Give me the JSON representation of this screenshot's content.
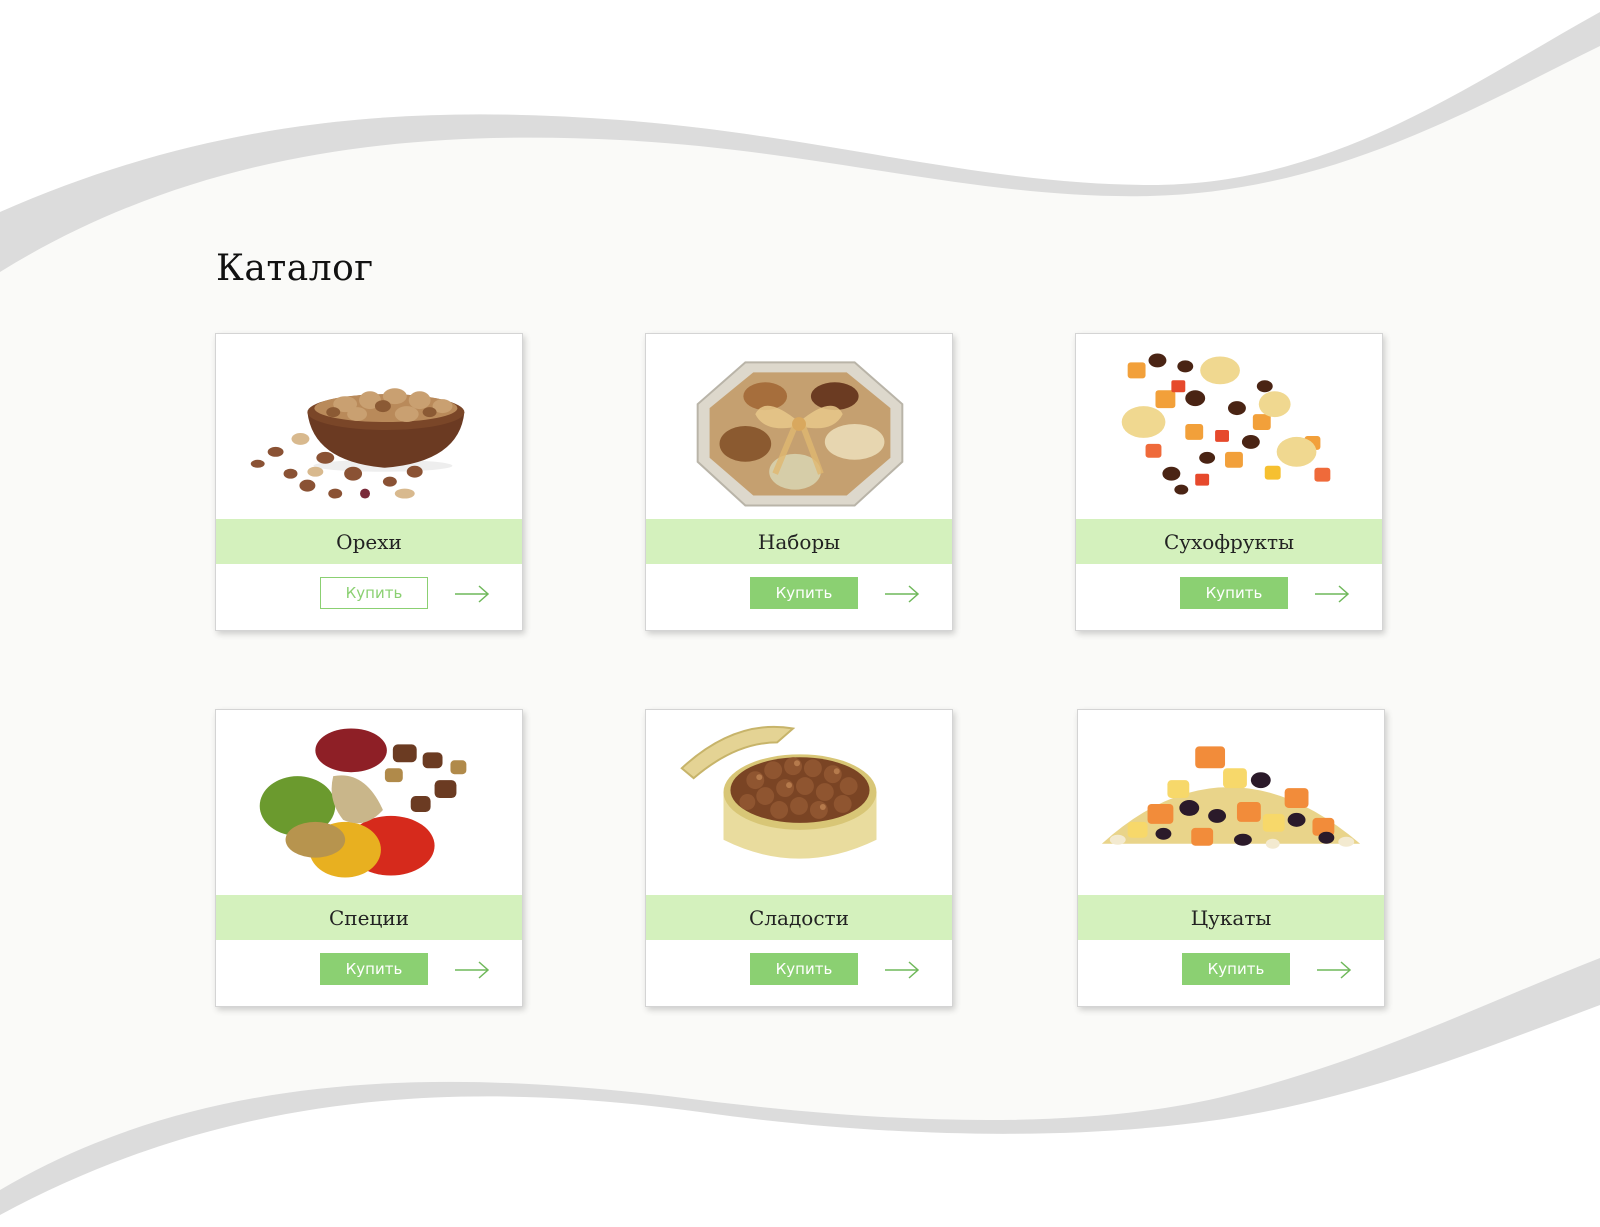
{
  "catalog": {
    "title": "Каталог",
    "buy_label": "Купить",
    "items": [
      {
        "name": "Орехи",
        "image": "nuts-bowl-image",
        "button_style": "outline"
      },
      {
        "name": "Наборы",
        "image": "gift-set-image",
        "button_style": "filled"
      },
      {
        "name": "Сухофрукты",
        "image": "dried-fruits-image",
        "button_style": "filled"
      },
      {
        "name": "Специи",
        "image": "spices-image",
        "button_style": "filled"
      },
      {
        "name": "Сладости",
        "image": "sweets-tin-image",
        "button_style": "filled"
      },
      {
        "name": "Цукаты",
        "image": "candied-fruits-image",
        "button_style": "filled"
      }
    ]
  },
  "colors": {
    "accent_green": "#8bd072",
    "label_band": "#d4f1bd",
    "wave_gray": "#dcdcdc",
    "background": "#fafaf8"
  },
  "icons": {
    "next": "arrow-right-icon"
  }
}
